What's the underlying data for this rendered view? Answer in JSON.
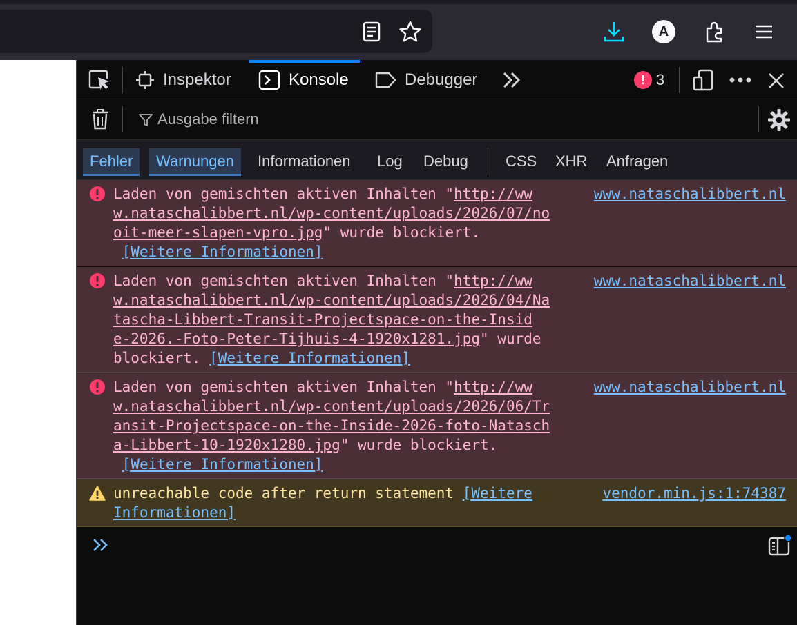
{
  "chrome": {
    "icons": [
      "reader-view-icon",
      "bookmark-star-icon",
      "downloads-icon",
      "account-icon",
      "extensions-icon",
      "menu-icon"
    ],
    "account_letter": "A",
    "download_color": "#00ddff"
  },
  "devtools": {
    "tabs": [
      {
        "label": "Inspektor",
        "icon": "inspector-icon"
      },
      {
        "label": "Konsole",
        "icon": "console-icon",
        "active": true
      },
      {
        "label": "Debugger",
        "icon": "debugger-icon"
      }
    ],
    "error_count": "3",
    "filter": {
      "placeholder": "Ausgabe filtern",
      "value": ""
    },
    "levels": [
      {
        "label": "Fehler",
        "on": true
      },
      {
        "label": "Warnungen",
        "on": true
      },
      {
        "label": "Informationen",
        "on": false
      },
      {
        "label": "Log",
        "on": false
      },
      {
        "label": "Debug",
        "on": false
      }
    ],
    "categories": [
      {
        "label": "CSS"
      },
      {
        "label": "XHR"
      },
      {
        "label": "Anfragen"
      }
    ],
    "messages": [
      {
        "type": "error",
        "pre": "Laden von gemischten aktiven Inhalten \"",
        "url_lines": [
          "http://ww",
          "w.nataschalibbert.nl/wp-content/uploads/2026/07/no",
          "oit-meer-slapen-vpro.jpg"
        ],
        "post": "\" wurde blockiert.",
        "learn_more": "[Weitere Informationen]",
        "source": "www.nataschalibbert.nl"
      },
      {
        "type": "error",
        "pre": "Laden von gemischten aktiven Inhalten \"",
        "url_lines": [
          "http://ww",
          "w.nataschalibbert.nl/wp-content/uploads/2026/04/Na",
          "tascha-Libbert-Transit-Projectspace-on-the-Insid",
          "e-2026.-Foto-Peter-Tijhuis-4-1920x1281.jpg"
        ],
        "post": "\" wurde",
        "post2": "blockiert.",
        "learn_more": "[Weitere Informationen]",
        "source": "www.nataschalibbert.nl"
      },
      {
        "type": "error",
        "pre": "Laden von gemischten aktiven Inhalten \"",
        "url_lines": [
          "http://ww",
          "w.nataschalibbert.nl/wp-content/uploads/2026/06/Tr",
          "ansit-Projectspace-on-the-Inside-2026-foto-Natasch",
          "a-Libbert-10-1920x1280.jpg"
        ],
        "post": "\" wurde blockiert.",
        "learn_more": "[Weitere Informationen]",
        "source": "www.nataschalibbert.nl"
      },
      {
        "type": "warning",
        "text": "unreachable code after return statement",
        "learn_more_1": "[Weitere",
        "learn_more_2": "Informationen]",
        "source": "vendor.min.js:1:74387"
      }
    ],
    "prompt": {
      "value": ""
    }
  }
}
